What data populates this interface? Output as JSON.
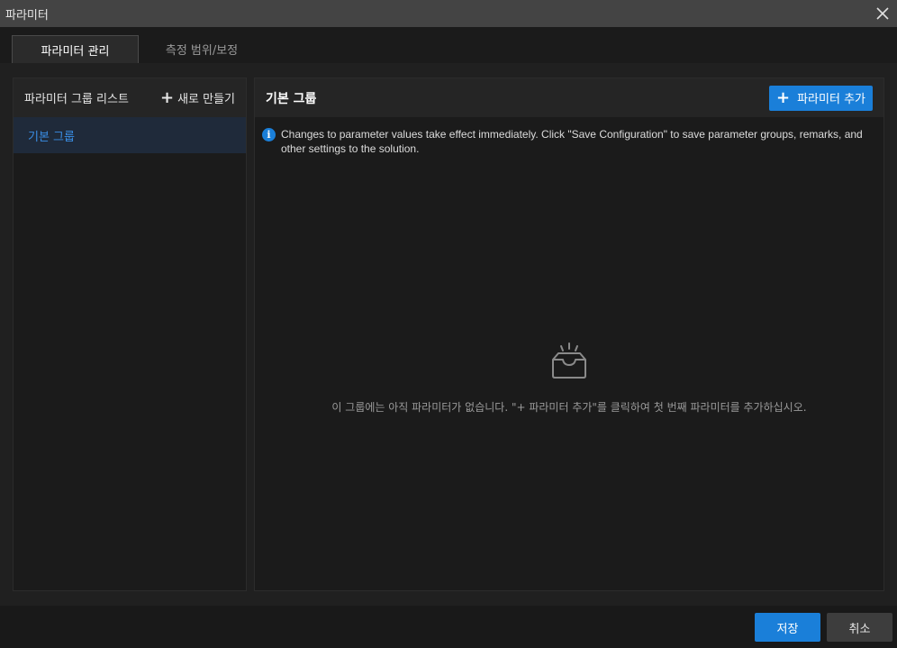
{
  "window": {
    "title": "파라미터",
    "close_icon": "close-icon"
  },
  "tabs": [
    {
      "label": "파라미터 관리",
      "active": true
    },
    {
      "label": "측정 범위/보정",
      "active": false
    }
  ],
  "left_panel": {
    "title": "파라미터 그룹 리스트",
    "new_button": "새로 만들기",
    "groups": [
      {
        "label": "기본 그룹",
        "selected": true
      }
    ]
  },
  "right_panel": {
    "title": "기본 그룹",
    "add_button": "파라미터 추가",
    "info_text": "Changes to parameter values take effect immediately. Click \"Save Configuration\" to save parameter groups, remarks, and other settings to the solution.",
    "empty_icon": "empty-inbox-icon",
    "empty_text": "이 그룹에는 아직 파라미터가 없습니다. \"+ 파라미터 추가\"를 클릭하여 첫 번째 파라미터를 추가하십시오."
  },
  "footer": {
    "save_label": "저장",
    "cancel_label": "취소"
  },
  "colors": {
    "accent": "#1a7fd9",
    "selected_text": "#3a8ee6",
    "background": "#1f1f1f"
  }
}
